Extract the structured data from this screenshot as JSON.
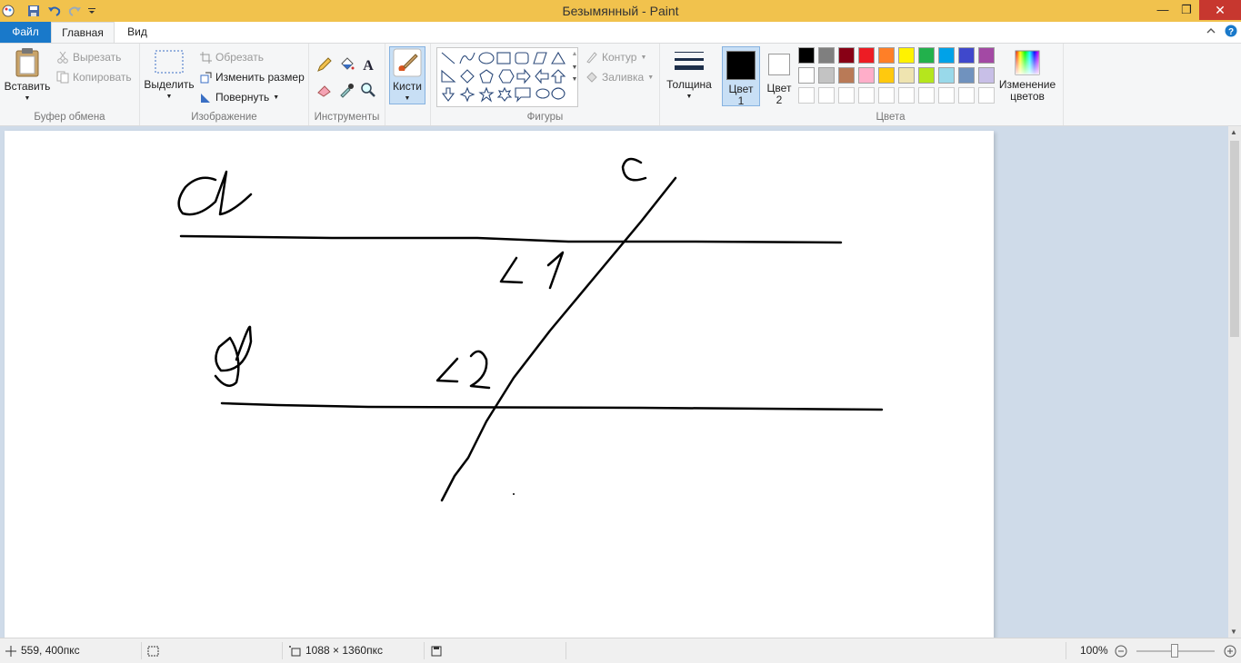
{
  "titlebar": {
    "title": "Безымянный - Paint",
    "close_glyph": "✕",
    "maximize_glyph": "❐",
    "minimize_glyph": "—"
  },
  "tabs": {
    "file": "Файл",
    "home": "Главная",
    "view": "Вид"
  },
  "ribbon": {
    "clipboard": {
      "group_label": "Буфер обмена",
      "paste": "Вставить",
      "cut": "Вырезать",
      "copy": "Копировать"
    },
    "image": {
      "group_label": "Изображение",
      "select": "Выделить",
      "crop": "Обрезать",
      "resize": "Изменить размер",
      "rotate": "Повернуть"
    },
    "tools": {
      "group_label": "Инструменты"
    },
    "brushes": {
      "label": "Кисти"
    },
    "shapes": {
      "group_label": "Фигуры",
      "outline": "Контур",
      "fill": "Заливка"
    },
    "size": {
      "label": "Толщина"
    },
    "colors": {
      "group_label": "Цвета",
      "color1_line1": "Цвет",
      "color1_line2": "1",
      "color2_line1": "Цвет",
      "color2_line2": "2",
      "edit_line1": "Изменение",
      "edit_line2": "цветов",
      "color1": "#000000",
      "color2": "#ffffff",
      "palette_row1": [
        "#000000",
        "#7f7f7f",
        "#880015",
        "#ed1c24",
        "#ff7f27",
        "#fff200",
        "#22b14c",
        "#00a2e8",
        "#3f48cc",
        "#a349a4"
      ],
      "palette_row2": [
        "#ffffff",
        "#c3c3c3",
        "#b97a57",
        "#ffaec9",
        "#ffc90e",
        "#efe4b0",
        "#b5e61d",
        "#99d9ea",
        "#7092be",
        "#c8bfe7"
      ]
    }
  },
  "canvas_labels": {
    "a": "a",
    "b": "в",
    "c": "c",
    "angle1": "∠1",
    "angle2": "∠2"
  },
  "status": {
    "cursor_pos": "559, 400пкс",
    "image_size": "1088 × 1360пкс",
    "zoom": "100%"
  }
}
